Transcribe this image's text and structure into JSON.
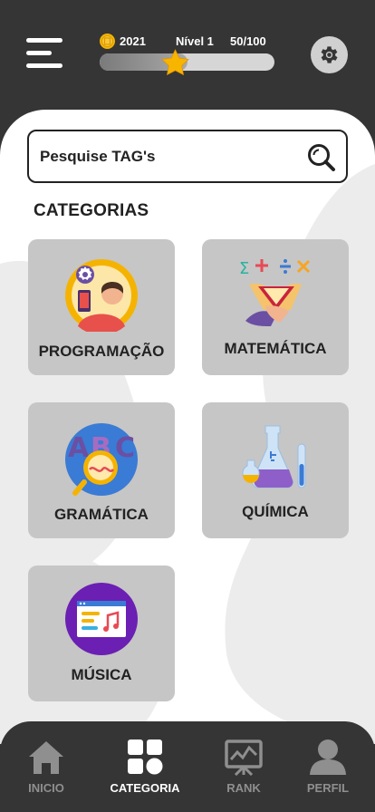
{
  "header": {
    "coins": "2021",
    "level_label": "Nível 1",
    "xp_text": "50/100",
    "xp_progress": 0.5,
    "menu_icon": "hamburger-menu-icon",
    "settings_icon": "gear-icon"
  },
  "search": {
    "placeholder": "Pesquise TAG's",
    "icon": "search-icon"
  },
  "categories_title": "CATEGORIAS",
  "categories": [
    {
      "label": "PROGRAMAÇÃO",
      "icon": "programming-icon"
    },
    {
      "label": "MATEMÁTICA",
      "icon": "math-icon"
    },
    {
      "label": "GRAMÁTICA",
      "icon": "grammar-icon"
    },
    {
      "label": "QUÍMICA",
      "icon": "chemistry-icon"
    },
    {
      "label": "MÚSICA",
      "icon": "music-icon"
    }
  ],
  "nav": [
    {
      "label": "INICIO",
      "icon": "home-icon",
      "active": false
    },
    {
      "label": "CATEGORIA",
      "icon": "category-grid-icon",
      "active": true
    },
    {
      "label": "RANK",
      "icon": "rank-chart-icon",
      "active": false
    },
    {
      "label": "PERFIL",
      "icon": "profile-icon",
      "active": false
    }
  ],
  "colors": {
    "header_bg": "#353535",
    "card_bg": "#c6c6c6",
    "accent_gold": "#f5b301",
    "nav_active": "#ffffff",
    "nav_inactive": "#8f8f8f"
  }
}
